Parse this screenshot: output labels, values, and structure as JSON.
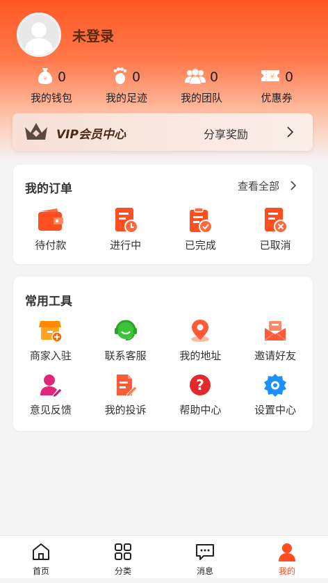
{
  "header": {
    "username": "未登录",
    "stats": [
      {
        "icon": "wallet-bag-icon",
        "value": "0",
        "label": "我的钱包"
      },
      {
        "icon": "footprint-icon",
        "value": "0",
        "label": "我的足迹"
      },
      {
        "icon": "team-icon",
        "value": "0",
        "label": "我的团队"
      },
      {
        "icon": "coupon-icon",
        "value": "0",
        "label": "优惠券"
      }
    ]
  },
  "vip": {
    "title": "VIP会员中心",
    "share_label": "分享奖励"
  },
  "orders": {
    "title": "我的订单",
    "view_all": "查看全部",
    "items": [
      {
        "icon": "wallet-icon",
        "label": "待付款"
      },
      {
        "icon": "in-progress-icon",
        "label": "进行中"
      },
      {
        "icon": "completed-icon",
        "label": "已完成"
      },
      {
        "icon": "cancelled-icon",
        "label": "已取消"
      }
    ]
  },
  "tools": {
    "title": "常用工具",
    "items": [
      {
        "icon": "merchant-icon",
        "label": "商家入驻"
      },
      {
        "icon": "customer-service-icon",
        "label": "联系客服"
      },
      {
        "icon": "location-icon",
        "label": "我的地址"
      },
      {
        "icon": "invite-icon",
        "label": "邀请好友"
      },
      {
        "icon": "feedback-icon",
        "label": "意见反馈"
      },
      {
        "icon": "complaint-icon",
        "label": "我的投诉"
      },
      {
        "icon": "help-icon",
        "label": "帮助中心"
      },
      {
        "icon": "settings-icon",
        "label": "设置中心"
      }
    ]
  },
  "tabbar": {
    "items": [
      {
        "icon": "home-icon",
        "label": "首页"
      },
      {
        "icon": "category-icon",
        "label": "分类"
      },
      {
        "icon": "message-icon",
        "label": "消息"
      },
      {
        "icon": "profile-icon",
        "label": "我的",
        "active": true
      }
    ]
  },
  "colors": {
    "accent": "#ff5722",
    "active_tab": "#ff4d20"
  }
}
